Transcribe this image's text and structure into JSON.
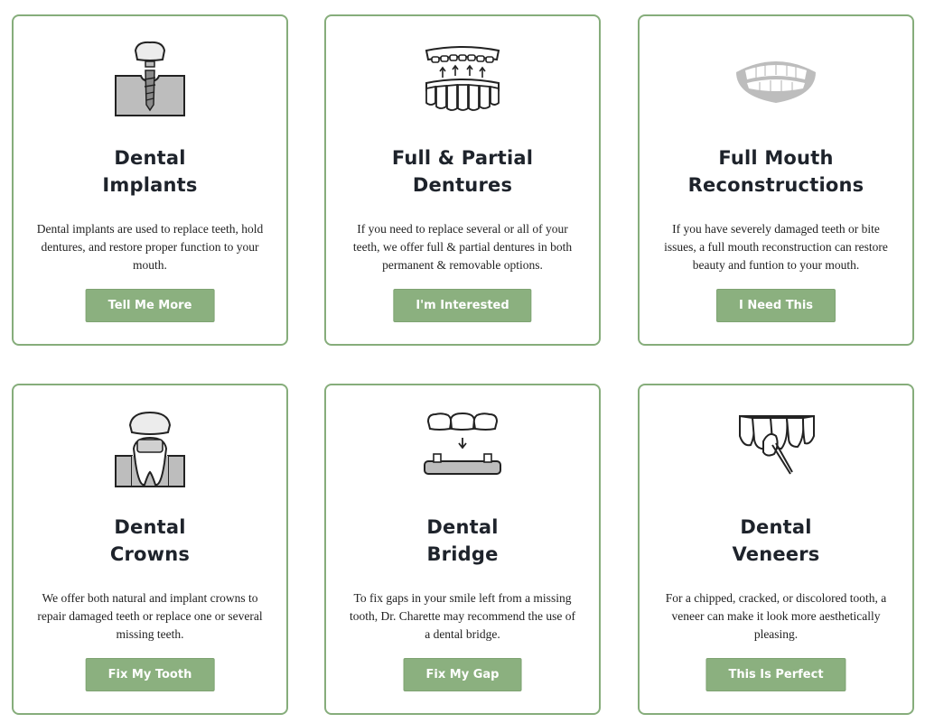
{
  "colors": {
    "accent": "#8bb07f",
    "border": "#86ad7b",
    "title": "#1e232b",
    "button_text": "#ffffff"
  },
  "cards": [
    {
      "icon": "dental-implant-icon",
      "title_line1": "Dental",
      "title_line2": "Implants",
      "description": "Dental implants are used to replace teeth, hold dentures, and restore proper function to your mouth.",
      "button": "Tell Me More"
    },
    {
      "icon": "dentures-icon",
      "title_line1": "Full & Partial",
      "title_line2": "Dentures",
      "description": "If you need to replace several or all of your teeth, we offer full & partial dentures in both permanent & removable options.",
      "button": "I'm Interested"
    },
    {
      "icon": "full-mouth-smile-icon",
      "title_line1": "Full Mouth",
      "title_line2": "Reconstructions",
      "description": "If you have severely damaged teeth or bite issues, a full mouth reconstruction can restore beauty and funtion to your mouth.",
      "button": "I Need This"
    },
    {
      "icon": "dental-crown-icon",
      "title_line1": "Dental",
      "title_line2": "Crowns",
      "description": "We offer both natural and implant crowns to repair damaged teeth or replace one or several missing teeth.",
      "button": "Fix My Tooth"
    },
    {
      "icon": "dental-bridge-icon",
      "title_line1": "Dental",
      "title_line2": "Bridge",
      "description": "To fix gaps in your smile left from a missing tooth, Dr. Charette may recommend the use of a dental bridge.",
      "button": "Fix My Gap"
    },
    {
      "icon": "dental-veneer-icon",
      "title_line1": "Dental",
      "title_line2": "Veneers",
      "description": "For a chipped, cracked, or discolored tooth, a veneer can make it look more aesthetically pleasing.",
      "button": "This Is Perfect"
    }
  ]
}
